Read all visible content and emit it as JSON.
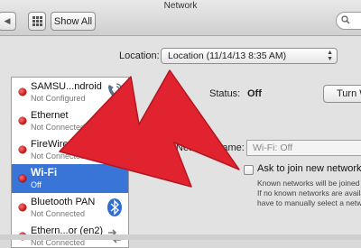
{
  "window": {
    "title": "Network"
  },
  "toolbar": {
    "show_all_label": "Show All"
  },
  "location": {
    "label": "Location:",
    "value": "Location (11/14/13 8:35 AM)"
  },
  "services": [
    {
      "name": "SAMSU...ndroid",
      "status": "Not Configured",
      "icon": "phone-icon"
    },
    {
      "name": "Ethernet",
      "status": "Not Connected",
      "icon": "ethernet-icon"
    },
    {
      "name": "FireWire",
      "status": "Not Connected",
      "icon": "firewire-icon"
    },
    {
      "name": "Wi-Fi",
      "status": "Off",
      "icon": "wifi-icon",
      "selected": true
    },
    {
      "name": "Bluetooth PAN",
      "status": "Not Connected",
      "icon": "bluetooth-icon"
    },
    {
      "name": "Ethern...or (en2)",
      "status": "Not Connected",
      "icon": "ethernet-icon"
    }
  ],
  "detail": {
    "status_label": "Status:",
    "status_value": "Off",
    "turn_button_label": "Turn Wi",
    "network_name_label": "Network Name:",
    "network_name_value": "Wi-Fi: Off",
    "ask_label": "Ask to join new networks",
    "help_lines": [
      "Known networks will be joined a",
      "If no known networks are availa",
      "have to manually select a networ"
    ]
  },
  "colors": {
    "selection": "#3875d7",
    "status_dot": "#d41414",
    "annotation_arrow": "#e0232e"
  }
}
